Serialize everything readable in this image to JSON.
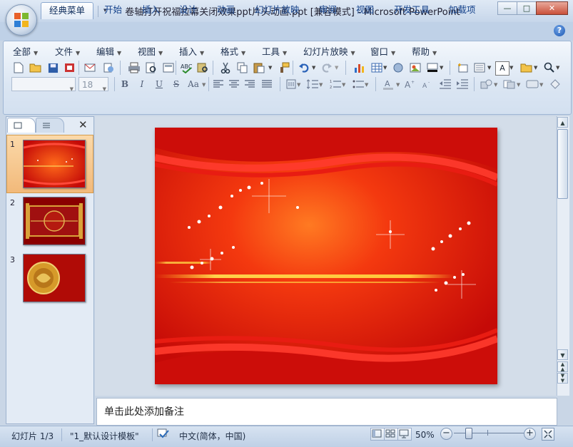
{
  "window": {
    "title": "卷轴打开祝福拉幕关闭效果ppt片头动画.ppt [兼容模式] - Microsoft PowerPoint",
    "minimize": "—",
    "maximize": "□",
    "close": "✕"
  },
  "ribbon_tabs": [
    {
      "label": "经典菜单",
      "active": true
    },
    {
      "label": "开始"
    },
    {
      "label": "插入"
    },
    {
      "label": "设计"
    },
    {
      "label": "动画"
    },
    {
      "label": "幻灯片放映"
    },
    {
      "label": "审阅"
    },
    {
      "label": "视图"
    },
    {
      "label": "开发工具"
    },
    {
      "label": "加载项"
    }
  ],
  "help_label": "?",
  "menus": [
    "全部",
    "文件",
    "编辑",
    "视图",
    "插入",
    "格式",
    "工具",
    "幻灯片放映",
    "窗口",
    "帮助"
  ],
  "format_bar": {
    "font_name": "",
    "font_size": "18",
    "bold": "B",
    "italic": "I",
    "underline": "U",
    "strike": "S",
    "case": "Aa"
  },
  "panes": {
    "close": "✕",
    "slides": [
      {
        "number": "1",
        "selected": true
      },
      {
        "number": "2"
      },
      {
        "number": "3"
      }
    ]
  },
  "notes_placeholder": "单击此处添加备注",
  "status": {
    "slide_counter": "幻灯片 1/3",
    "template": "\"1_默认设计模板\"",
    "language": "中文(简体，中国)",
    "zoom": "50%"
  },
  "colors": {
    "slide_red": "#e0120c",
    "selected_thumb": "#f5c48a",
    "accent_blue": "#15428b"
  }
}
